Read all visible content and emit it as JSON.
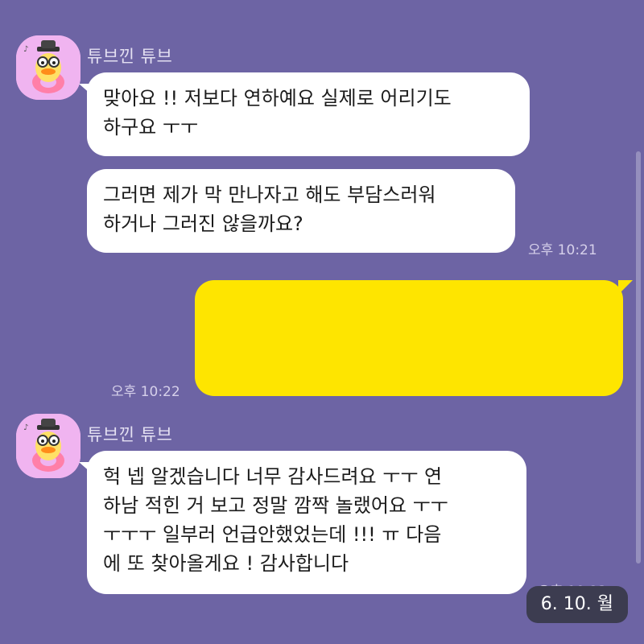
{
  "chat": {
    "sender_name": "튜브낀 튜브",
    "groups": [
      {
        "messages": [
          "맞아요 !! 저보다 연하예요 실제로 어리기도\n하구요 ㅜㅜ",
          "그러면 제가 막 만나자고 해도 부담스러워\n하거나 그러진 않을까요?"
        ],
        "time": "오후 10:21"
      },
      {
        "messages": [
          "헉 넵 알겠습니다 너무 감사드려요 ㅜㅜ 연\n하남 적힌 거 보고 정말 깜짝 놀랬어요 ㅜㅜ\nㅜㅜㅜ 일부러 언급안했었는데 !!! ㅠ 다음\n에 또 찾아올게요 ! 감사합니다"
        ],
        "time": "오후 10:23"
      }
    ],
    "my_message": {
      "text": "",
      "time": "오후 10:22"
    },
    "date_pill": "6. 10. 월"
  },
  "colors": {
    "background": "#6d64a4",
    "incoming_bubble": "#ffffff",
    "outgoing_bubble": "#fee500",
    "date_pill": "#3c3c50"
  },
  "icons": {
    "avatar": "duck-tube-character-icon"
  }
}
